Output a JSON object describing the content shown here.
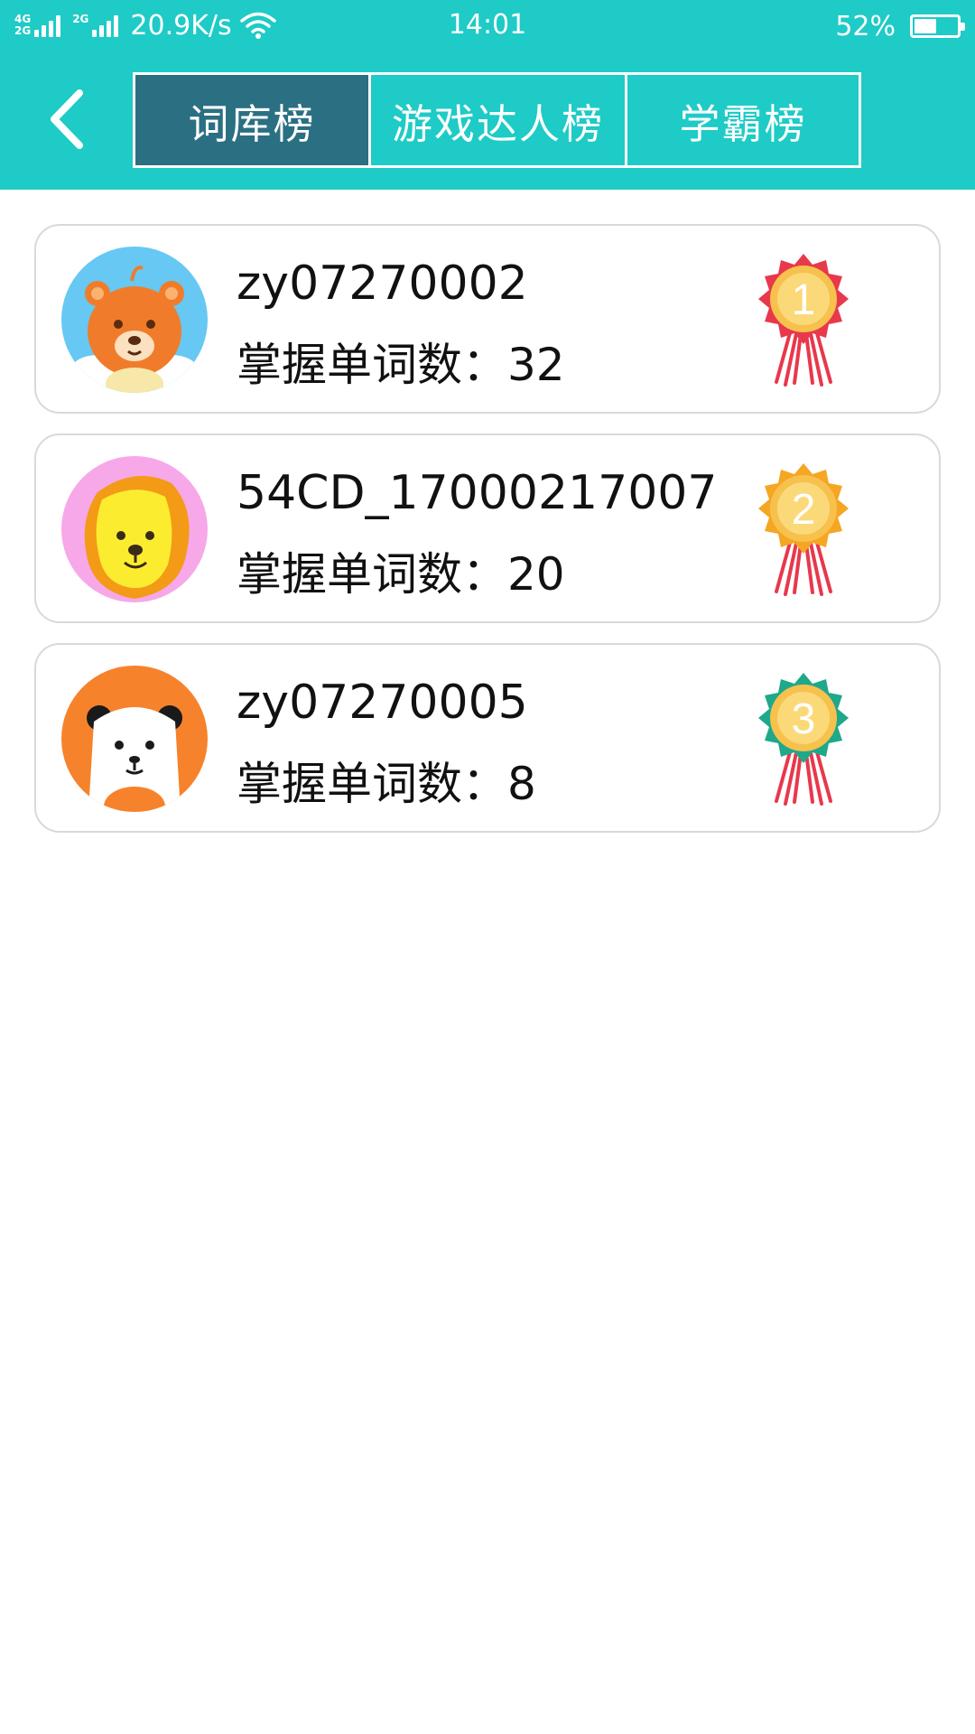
{
  "status_bar": {
    "network_top": "4G",
    "network_bottom": "2G",
    "network_2": "2G",
    "speed": "20.9K/s",
    "time": "14:01",
    "battery": "52%",
    "battery_level": 0.52
  },
  "nav": {
    "tabs": [
      {
        "label": "词库榜",
        "active": true
      },
      {
        "label": "游戏达人榜",
        "active": false
      },
      {
        "label": "学霸榜",
        "active": false
      }
    ]
  },
  "leaderboard": {
    "count_label": "掌握单词数：",
    "entries": [
      {
        "rank": "1",
        "username": "zy07270002",
        "count": "32",
        "avatar": "bear-avatar-icon",
        "medal_color": "#e8384c"
      },
      {
        "rank": "2",
        "username": "54CD_17000217007",
        "count": "20",
        "avatar": "lion-avatar-icon",
        "medal_color": "#f5a623"
      },
      {
        "rank": "3",
        "username": "zy07270005",
        "count": "8",
        "avatar": "panda-avatar-icon",
        "medal_color": "#1fa88a"
      }
    ]
  },
  "colors": {
    "header_bg": "#1ecbc6",
    "active_tab_bg": "#2b6f82"
  }
}
